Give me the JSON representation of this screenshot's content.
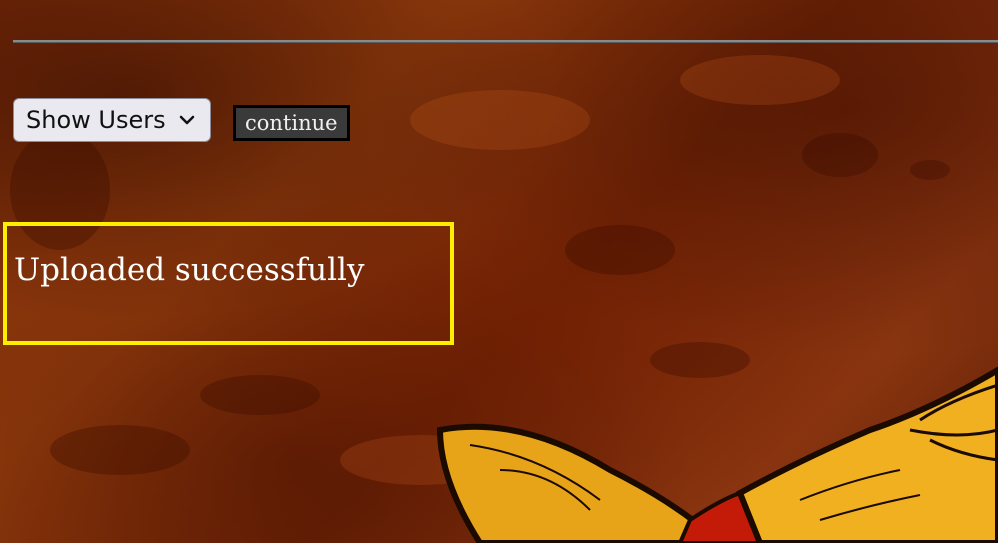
{
  "controls": {
    "select_value": "Show Users",
    "continue_label": "continue"
  },
  "status": {
    "message": "Uploaded successfully"
  },
  "colors": {
    "status_border": "#ffee00",
    "button_bg": "#3a3a3a",
    "background": "#7a2a08"
  },
  "icons": {
    "select_arrow": "chevron-down-icon"
  }
}
